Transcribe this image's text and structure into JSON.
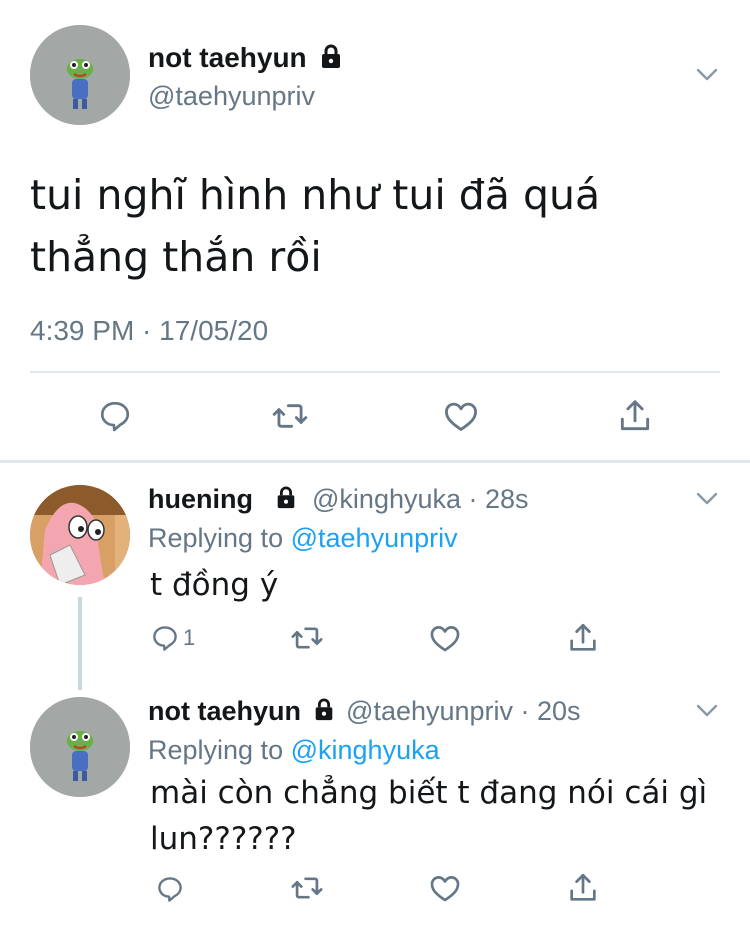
{
  "main_tweet": {
    "display_name": "not taehyun",
    "handle": "@taehyunpriv",
    "text_line1": "tui nghĩ hình như tui đã quá",
    "text_line2": "thẳng thắn rồi",
    "timestamp": "4:39 PM · 17/05/20"
  },
  "replies": [
    {
      "display_name": "huening",
      "handle_time": "@kinghyuka · 28s",
      "replying_prefix": "Replying to",
      "replying_to": "@taehyunpriv",
      "text_line1": "t đồng ý",
      "text_line2": "",
      "reply_count": "1"
    },
    {
      "display_name": "not taehyun",
      "handle_time": "@taehyunpriv · 20s",
      "replying_prefix": "Replying to",
      "replying_to": "@kinghyuka",
      "text_line1": "mài còn chẳng biết t đang nói cái gì",
      "text_line2": "lun??????",
      "reply_count": ""
    }
  ],
  "icons": {
    "reply": "reply-icon",
    "retweet": "retweet-icon",
    "like": "like-icon",
    "share": "share-icon",
    "lock": "lock-icon",
    "chevron": "chevron-down-icon"
  },
  "colors": {
    "link": "#1da1f2",
    "secondary_text": "#657786",
    "divider": "#e1e8ed"
  }
}
